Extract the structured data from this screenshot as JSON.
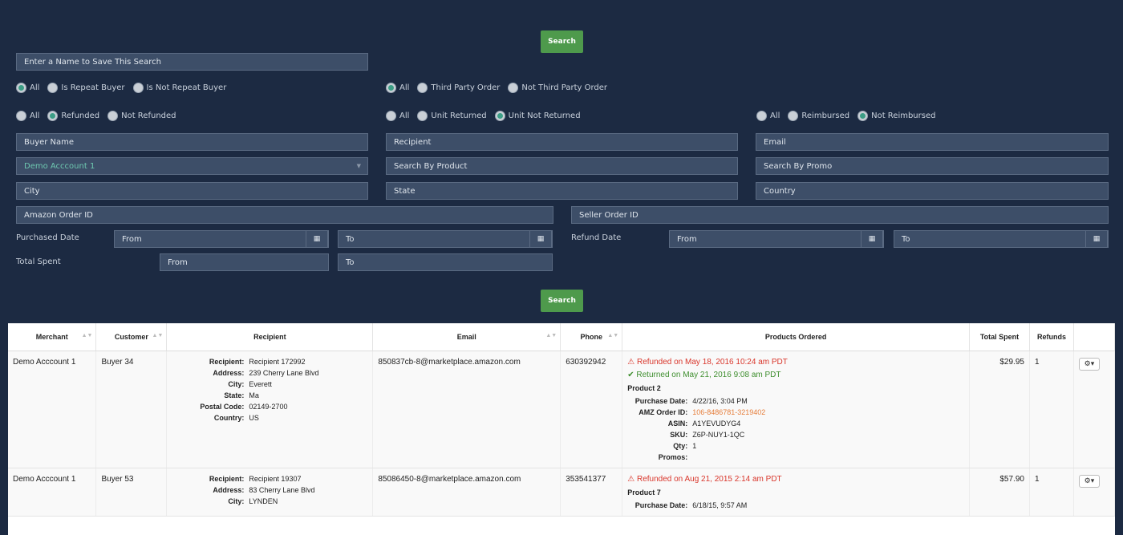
{
  "search_label": "Search",
  "save_search_placeholder": "Enter a Name to Save This Search",
  "repeat_buyer": {
    "options": [
      "All",
      "Is Repeat Buyer",
      "Is Not Repeat Buyer"
    ],
    "selected": 0
  },
  "third_party": {
    "options": [
      "All",
      "Third Party Order",
      "Not Third Party Order"
    ],
    "selected": 0
  },
  "refund": {
    "options": [
      "All",
      "Refunded",
      "Not Refunded"
    ],
    "selected": 1
  },
  "unit_returned": {
    "options": [
      "All",
      "Unit Returned",
      "Unit Not Returned"
    ],
    "selected": 2
  },
  "reimbursed": {
    "options": [
      "All",
      "Reimbursed",
      "Not Reimbursed"
    ],
    "selected": 2
  },
  "fields": {
    "buyer_name": "Buyer Name",
    "recipient": "Recipient",
    "email": "Email",
    "merchant_select": "Demo Acccount 1",
    "search_product": "Search By Product",
    "search_promo": "Search By Promo",
    "city": "City",
    "state": "State",
    "country": "Country",
    "amazon_order_id": "Amazon Order ID",
    "seller_order_id": "Seller Order ID"
  },
  "purchased_date": {
    "label": "Purchased Date",
    "from": "From",
    "to": "To"
  },
  "refund_date": {
    "label": "Refund Date",
    "from": "From",
    "to": "To"
  },
  "total_spent": {
    "label": "Total Spent",
    "from": "From",
    "to": "To"
  },
  "table": {
    "headers": [
      "Merchant",
      "Customer",
      "Recipient",
      "Email",
      "Phone",
      "Products Ordered",
      "Total Spent",
      "Refunds"
    ],
    "rows": [
      {
        "merchant": "Demo Acccount 1",
        "customer": "Buyer 34",
        "recipient_details": [
          [
            "Recipient:",
            "Recipient 172992"
          ],
          [
            "Address:",
            "239 Cherry Lane Blvd"
          ],
          [
            "City:",
            "Everett"
          ],
          [
            "State:",
            "Ma"
          ],
          [
            "Postal Code:",
            "02149-2700"
          ],
          [
            "Country:",
            "US"
          ]
        ],
        "email": "850837cb-8@marketplace.amazon.com",
        "phone": "630392942",
        "refund_status": "Refunded on May 18, 2016 10:24 am PDT",
        "return_status": "Returned on May 21, 2016 9:08 am PDT",
        "product": "Product 2",
        "product_details": [
          [
            "Purchase Date:",
            "4/22/16, 3:04 PM"
          ],
          [
            "AMZ Order ID:",
            "106-8486781-3219402"
          ],
          [
            "ASIN:",
            "A1YEVUDYG4"
          ],
          [
            "SKU:",
            "Z6P-NUY1-1QC"
          ],
          [
            "Qty:",
            "1"
          ],
          [
            "Promos:",
            ""
          ]
        ],
        "total_spent": "$29.95",
        "refunds": "1"
      },
      {
        "merchant": "Demo Acccount 1",
        "customer": "Buyer 53",
        "recipient_details": [
          [
            "Recipient:",
            "Recipient 19307"
          ],
          [
            "Address:",
            "83 Cherry Lane Blvd"
          ],
          [
            "City:",
            "LYNDEN"
          ]
        ],
        "email": "85086450-8@marketplace.amazon.com",
        "phone": "353541377",
        "refund_status": "Refunded on Aug 21, 2015 2:14 am PDT",
        "product": "Product 7",
        "product_details": [
          [
            "Purchase Date:",
            "6/18/15, 9:57 AM"
          ]
        ],
        "total_spent": "$57.90",
        "refunds": "1"
      }
    ]
  }
}
